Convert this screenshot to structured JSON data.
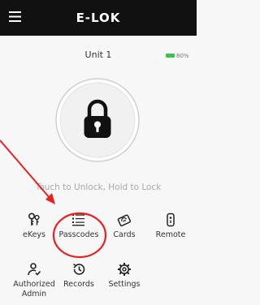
{
  "header": {
    "title": "E-LOK",
    "menu_icon": "hamburger-menu-icon"
  },
  "device": {
    "name": "Unit 1",
    "battery_percent_label": "80%",
    "battery_level": 0.8,
    "battery_color": "#39c54d"
  },
  "lock": {
    "icon": "padlock-icon",
    "hint": "Touch to Unlock, Hold to Lock"
  },
  "menu": [
    {
      "label": "eKeys",
      "icon": "ekey-icon"
    },
    {
      "label": "Passcodes",
      "icon": "passcode-list-icon"
    },
    {
      "label": "Cards",
      "icon": "card-icon"
    },
    {
      "label": "Remote",
      "icon": "remote-icon"
    },
    {
      "label": "Authorized Admin",
      "icon": "authorized-admin-icon"
    },
    {
      "label": "Records",
      "icon": "records-icon"
    },
    {
      "label": "Settings",
      "icon": "settings-icon"
    }
  ],
  "annotation": {
    "color": "#e8201f",
    "highlight": "Passcodes"
  }
}
